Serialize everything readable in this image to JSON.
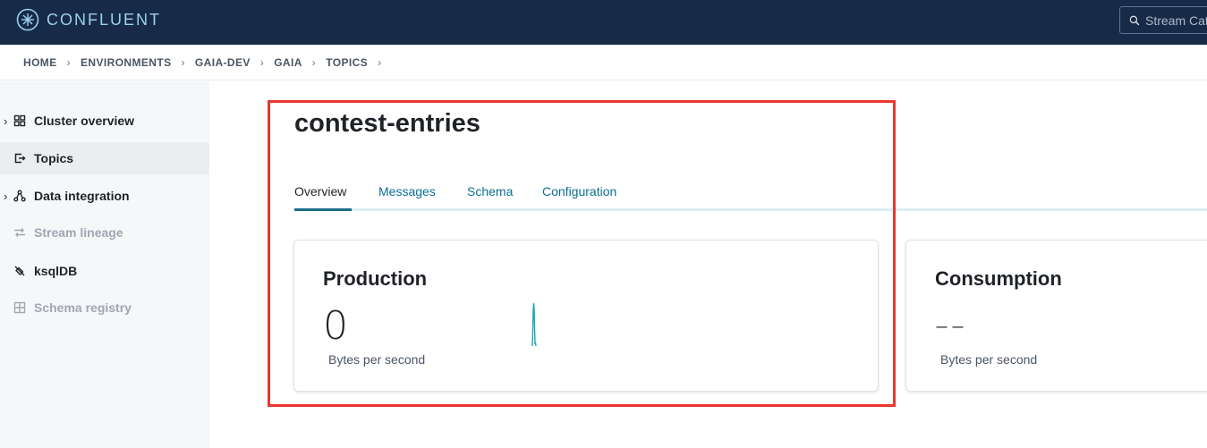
{
  "app": {
    "brand": "CONFLUENT"
  },
  "search": {
    "placeholder": "Stream Catalog"
  },
  "breadcrumb": [
    "HOME",
    "ENVIRONMENTS",
    "GAIA-DEV",
    "GAIA",
    "TOPICS"
  ],
  "sidebar": {
    "items": [
      {
        "label": "Cluster overview",
        "icon": "grid-icon",
        "expandable": true,
        "active": false,
        "disabled": false
      },
      {
        "label": "Topics",
        "icon": "topics-icon",
        "expandable": false,
        "active": true,
        "disabled": false
      },
      {
        "label": "Data integration",
        "icon": "integration-icon",
        "expandable": true,
        "active": false,
        "disabled": false
      },
      {
        "label": "Stream lineage",
        "icon": "lineage-icon",
        "expandable": false,
        "active": false,
        "disabled": true
      },
      {
        "label": "ksqlDB",
        "icon": "ksqldb-icon",
        "expandable": false,
        "active": false,
        "disabled": false
      },
      {
        "label": "Schema registry",
        "icon": "schema-icon",
        "expandable": false,
        "active": false,
        "disabled": true
      }
    ]
  },
  "topic": {
    "name": "contest-entries",
    "tabs": [
      "Overview",
      "Messages",
      "Schema",
      "Configuration"
    ],
    "active_tab": "Overview"
  },
  "production": {
    "title": "Production",
    "value": "0",
    "unit": "Bytes per second"
  },
  "consumption": {
    "title": "Consumption",
    "value": "––",
    "unit": "Bytes per second"
  },
  "colors": {
    "topbar": "#172a47",
    "accent": "#0a6f94",
    "sparkline": "#1aa5b8",
    "highlight": "#e8382f"
  }
}
